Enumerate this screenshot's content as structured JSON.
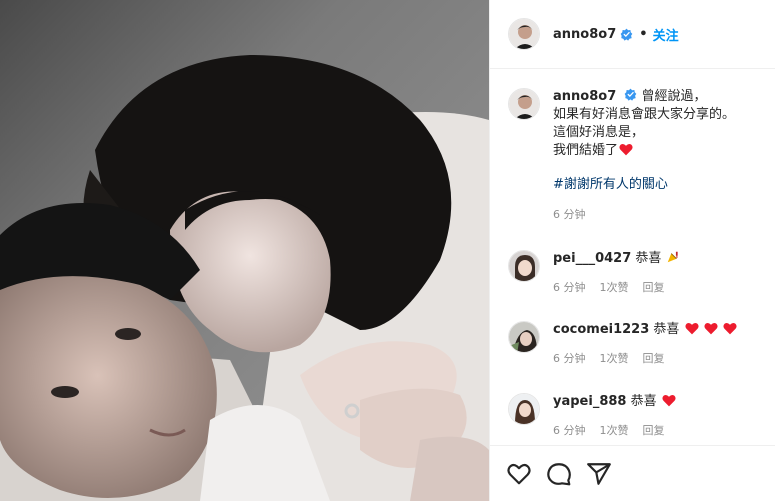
{
  "account": {
    "username": "anno8o7",
    "verified": true,
    "follow_label": "关注"
  },
  "caption": {
    "lines": [
      "曾經說過，",
      "如果有好消息會跟大家分享的。",
      "這個好消息是，",
      "我們結婚了"
    ],
    "hashtag": "#謝謝所有人的關心",
    "time": "6 分钟"
  },
  "comments": [
    {
      "username": "pei___0427",
      "text": "恭喜",
      "emoji": [
        "party-popper-icon"
      ],
      "time": "6 分钟",
      "likes": "1次赞",
      "reply": "回复"
    },
    {
      "username": "cocomei1223",
      "text": "恭喜",
      "emoji": [
        "red-heart-icon",
        "red-heart-icon",
        "red-heart-icon"
      ],
      "time": "6 分钟",
      "likes": "1次赞",
      "reply": "回复"
    },
    {
      "username": "yapei_888",
      "text": "恭喜",
      "emoji": [
        "red-heart-icon"
      ],
      "time": "6 分钟",
      "likes": "1次赞",
      "reply": "回复"
    }
  ],
  "actions": [
    "heart-icon",
    "comment-icon",
    "share-icon"
  ],
  "colors": {
    "link": "#0095f6",
    "hashtag": "#00376b",
    "meta": "#8e8e8e",
    "heart": "#ed1c2e",
    "verified": "#3897f0"
  }
}
